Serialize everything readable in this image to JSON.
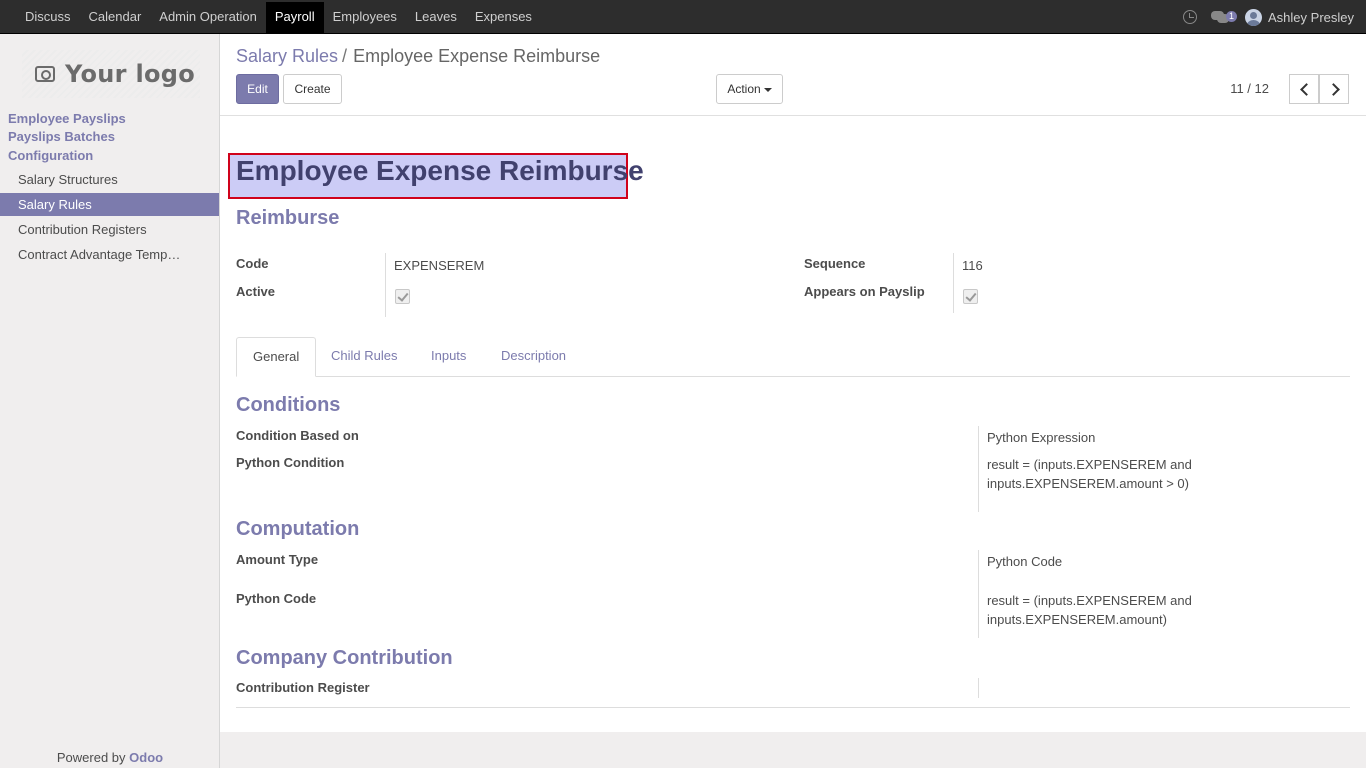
{
  "topbar": {
    "menu": [
      "Discuss",
      "Calendar",
      "Admin Operation",
      "Payroll",
      "Employees",
      "Leaves",
      "Expenses"
    ],
    "active_menu": "Payroll",
    "chat_count": "1",
    "user_name": "Ashley Presley"
  },
  "sidebar": {
    "logo_text": "Your logo",
    "sections": [
      "Employee Payslips",
      "Payslips Batches",
      "Configuration"
    ],
    "items": [
      "Salary Structures",
      "Salary Rules",
      "Contribution Registers",
      "Contract Advantage Temp…"
    ],
    "active_item": "Salary Rules",
    "powered_prefix": "Powered by",
    "powered_brand": "Odoo"
  },
  "control_panel": {
    "breadcrumb_parent": "Salary Rules",
    "breadcrumb_sep": "/",
    "breadcrumb_current": "Employee Expense Reimburse",
    "edit_label": "Edit",
    "create_label": "Create",
    "action_label": "Action",
    "pager": "11 / 12"
  },
  "form": {
    "name": "Employee Expense Reimburse",
    "category": "Reimburse",
    "code_label": "Code",
    "code_value": "EXPENSEREM",
    "active_label": "Active",
    "active_checked": true,
    "sequence_label": "Sequence",
    "sequence_value": "116",
    "appears_label": "Appears on Payslip",
    "appears_checked": true,
    "tabs": [
      "General",
      "Child Rules",
      "Inputs",
      "Description"
    ],
    "active_tab": "General",
    "conditions": {
      "title": "Conditions",
      "based_on_label": "Condition Based on",
      "based_on_value": "Python Expression",
      "python_condition_label": "Python Condition",
      "python_condition_line1": "result = (inputs.EXPENSEREM and",
      "python_condition_line2": "inputs.EXPENSEREM.amount > 0)"
    },
    "computation": {
      "title": "Computation",
      "amount_type_label": "Amount Type",
      "amount_type_value": "Python Code",
      "python_code_label": "Python Code",
      "python_code_line1": "result = (inputs.EXPENSEREM and",
      "python_code_line2": "inputs.EXPENSEREM.amount)"
    },
    "company_contribution": {
      "title": "Company Contribution",
      "register_label": "Contribution Register",
      "register_value": ""
    }
  },
  "colors": {
    "accent": "#7c7bad",
    "topbar": "#2d2d2d",
    "title_highlight": "#ccccf6",
    "highlight_border": "#d0021b"
  }
}
